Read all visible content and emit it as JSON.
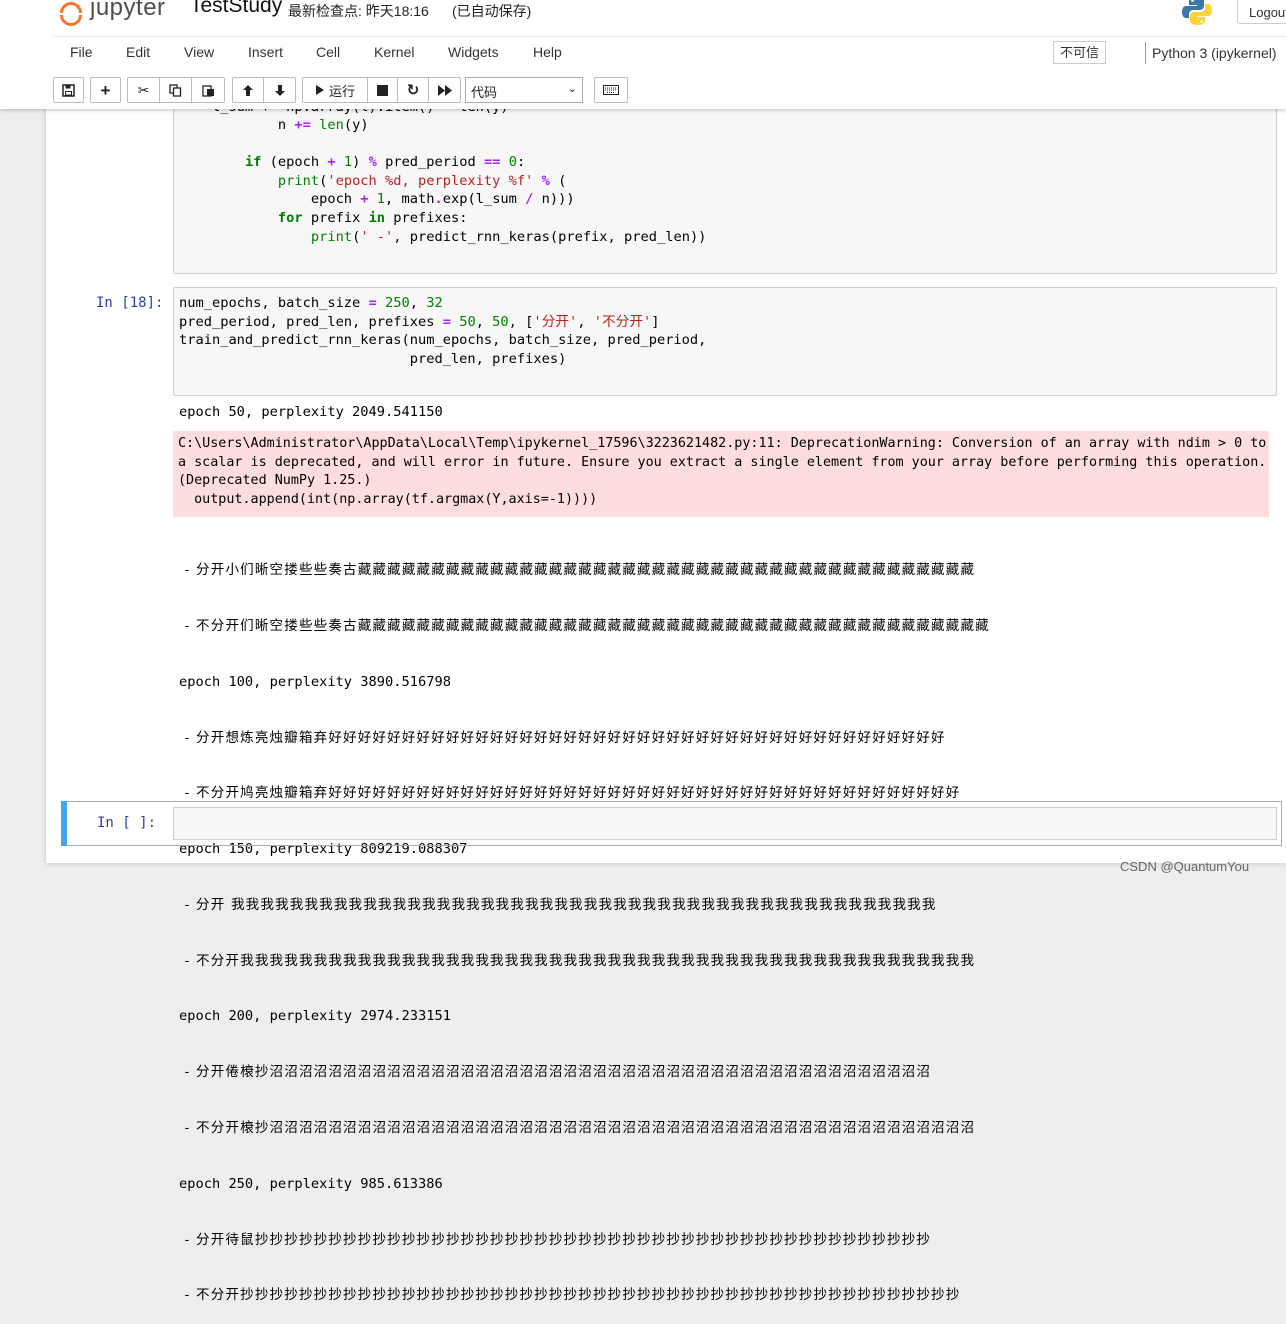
{
  "header": {
    "logo_text": "jupyter",
    "notebook_name": "TestStudy",
    "checkpoint": "最新检查点: 昨天18:16",
    "autosave": "(已自动保存)",
    "logout": "Logout"
  },
  "menu": [
    "File",
    "Edit",
    "View",
    "Insert",
    "Cell",
    "Kernel",
    "Widgets",
    "Help"
  ],
  "trust": "不可信",
  "kernel": "Python 3 (ipykernel)",
  "toolbar": {
    "run_label": "运行",
    "cell_type": "代码",
    "icons": [
      "save-icon",
      "plus-icon",
      "scissors-icon",
      "copy-icon",
      "paste-icon",
      "arrow-up-icon",
      "arrow-down-icon",
      "play-icon",
      "stop-icon",
      "restart-icon",
      "fast-forward-icon",
      "keyboard-icon"
    ]
  },
  "cells": {
    "prev_code_partial_line": "    l_sum += np.array(l).item() * len(y)",
    "prev_code": [
      "            n += len(y)",
      "",
      "        if (epoch + 1) % pred_period == 0:",
      "            print('epoch %d, perplexity %f' % (",
      "                epoch + 1, math.exp(l_sum / n)))",
      "            for prefix in prefixes:",
      "                print(' -', predict_rnn_keras(prefix, pred_len))"
    ],
    "run_prompt": "In [18]:",
    "run_code": [
      "num_epochs, batch_size = 250, 32",
      "pred_period, pred_len, prefixes = 50, 50, ['分开', '不分开']",
      "train_and_predict_rnn_keras(num_epochs, batch_size, pred_period,",
      "                            pred_len, prefixes)"
    ],
    "output_first": "epoch 50, perplexity 2049.541150",
    "stderr": [
      "C:\\Users\\Administrator\\AppData\\Local\\Temp\\ipykernel_17596\\3223621482.py:11: DeprecationWarning: Conversion of an array with ndim > 0 to",
      "a scalar is deprecated, and will error in future. Ensure you extract a single element from your array before performing this operation.",
      "(Deprecated NumPy 1.25.)",
      "  output.append(int(np.array(tf.argmax(Y,axis=-1))))"
    ],
    "output_log": [
      " - 分开小们晰空搂些些奏古藏藏藏藏藏藏藏藏藏藏藏藏藏藏藏藏藏藏藏藏藏藏藏藏藏藏藏藏藏藏藏藏藏藏藏藏藏藏藏藏藏藏",
      " - 不分开们晰空搂些些奏古藏藏藏藏藏藏藏藏藏藏藏藏藏藏藏藏藏藏藏藏藏藏藏藏藏藏藏藏藏藏藏藏藏藏藏藏藏藏藏藏藏藏藏",
      "epoch 100, perplexity 3890.516798",
      " - 分开想炼亮烛瓣箱弃好好好好好好好好好好好好好好好好好好好好好好好好好好好好好好好好好好好好好好好好好好",
      " - 不分开鸠亮烛瓣箱弃好好好好好好好好好好好好好好好好好好好好好好好好好好好好好好好好好好好好好好好好好好好",
      "epoch 150, perplexity 809219.088307",
      " - 分开 我我我我我我我我我我我我我我我我我我我我我我我我我我我我我我我我我我我我我我我我我我我我我我我我",
      " - 不分开我我我我我我我我我我我我我我我我我我我我我我我我我我我我我我我我我我我我我我我我我我我我我我我我我我",
      "epoch 200, perplexity 2974.233151",
      " - 分开倦榱抄沼沼沼沼沼沼沼沼沼沼沼沼沼沼沼沼沼沼沼沼沼沼沼沼沼沼沼沼沼沼沼沼沼沼沼沼沼沼沼沼沼沼沼沼沼",
      " - 不分开榱抄沼沼沼沼沼沼沼沼沼沼沼沼沼沼沼沼沼沼沼沼沼沼沼沼沼沼沼沼沼沼沼沼沼沼沼沼沼沼沼沼沼沼沼沼沼沼沼沼",
      "epoch 250, perplexity 985.613386",
      " - 分开待鼠抄抄抄抄抄抄抄抄抄抄抄抄抄抄抄抄抄抄抄抄抄抄抄抄抄抄抄抄抄抄抄抄抄抄抄抄抄抄抄抄抄抄抄抄抄抄",
      " - 不分开抄抄抄抄抄抄抄抄抄抄抄抄抄抄抄抄抄抄抄抄抄抄抄抄抄抄抄抄抄抄抄抄抄抄抄抄抄抄抄抄抄抄抄抄抄抄抄抄抄"
    ],
    "empty_prompt": "In [ ]:"
  },
  "watermark": "CSDN @QuantumYou",
  "colors": {
    "accent": "#42a5f5",
    "stderr_bg": "#fddddd",
    "prompt": "#303f9f",
    "logo_orange": "#f37726"
  }
}
